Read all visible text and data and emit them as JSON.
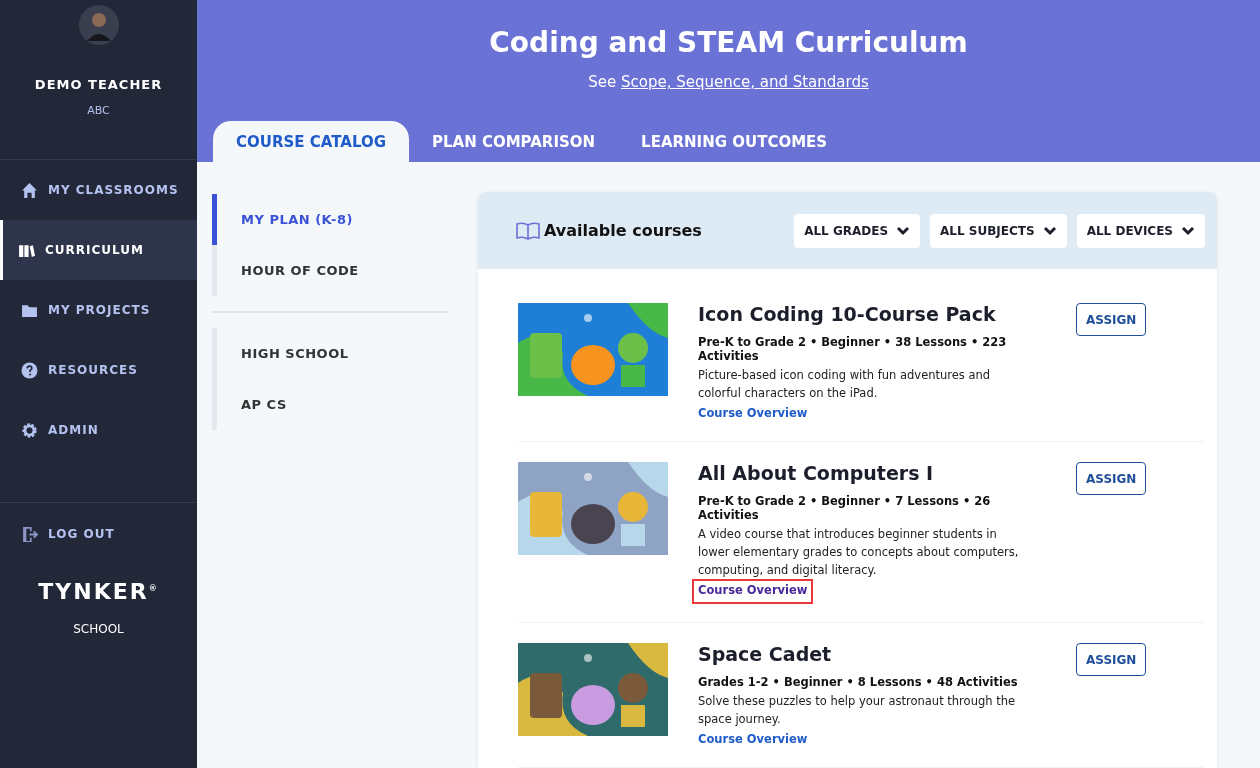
{
  "sidebar": {
    "user_name": "DEMO TEACHER",
    "user_org": "ABC",
    "items": [
      {
        "label": "MY CLASSROOMS",
        "selected": false
      },
      {
        "label": "CURRICULUM",
        "selected": true
      },
      {
        "label": "MY PROJECTS",
        "selected": false
      },
      {
        "label": "RESOURCES",
        "selected": false
      },
      {
        "label": "ADMIN",
        "selected": false
      }
    ],
    "logout": "LOG OUT",
    "logo": "TYNKER",
    "logo_mark": "®",
    "logo_sub": "SCHOOL"
  },
  "header": {
    "title": "Coding and STEAM Curriculum",
    "subtitle": "See",
    "subtitle_link": "Scope, Sequence, and Standards"
  },
  "tabs": [
    {
      "label": "COURSE CATALOG",
      "selected": true
    },
    {
      "label": "PLAN COMPARISON",
      "selected": false
    },
    {
      "label": "LEARNING OUTCOMES",
      "selected": false
    }
  ],
  "plans": [
    [
      {
        "label": "MY PLAN (K-8)",
        "selected": true
      },
      {
        "label": "HOUR OF CODE",
        "selected": false
      }
    ],
    [
      {
        "label": "HIGH SCHOOL",
        "selected": false
      },
      {
        "label": "AP CS",
        "selected": false
      }
    ]
  ],
  "catalog": {
    "title": "Available courses",
    "filters": [
      "ALL GRADES",
      "ALL SUBJECTS",
      "ALL DEVICES"
    ],
    "courses": [
      {
        "title": "Icon Coding 10-Course Pack",
        "meta": "Pre-K to Grade 2 • Beginner • 38 Lessons • 223 Activities",
        "description": "Picture-based icon coding with fun adventures and colorful characters on the iPad.",
        "link": "Course Overview",
        "highlighted": false,
        "button": "ASSIGN"
      },
      {
        "title": "All About Computers I",
        "meta": "Pre-K to Grade 2 • Beginner • 7 Lessons • 26 Activities",
        "description": "A video course that introduces beginner students in lower elementary grades to concepts about computers, computing, and digital literacy.",
        "link": "Course Overview",
        "highlighted": true,
        "button": "ASSIGN"
      },
      {
        "title": "Space Cadet",
        "meta": "Grades 1-2 • Beginner • 8 Lessons • 48 Activities",
        "description": "Solve these puzzles to help your astronaut through the space journey.",
        "link": "Course Overview",
        "highlighted": false,
        "button": "ASSIGN"
      }
    ]
  }
}
